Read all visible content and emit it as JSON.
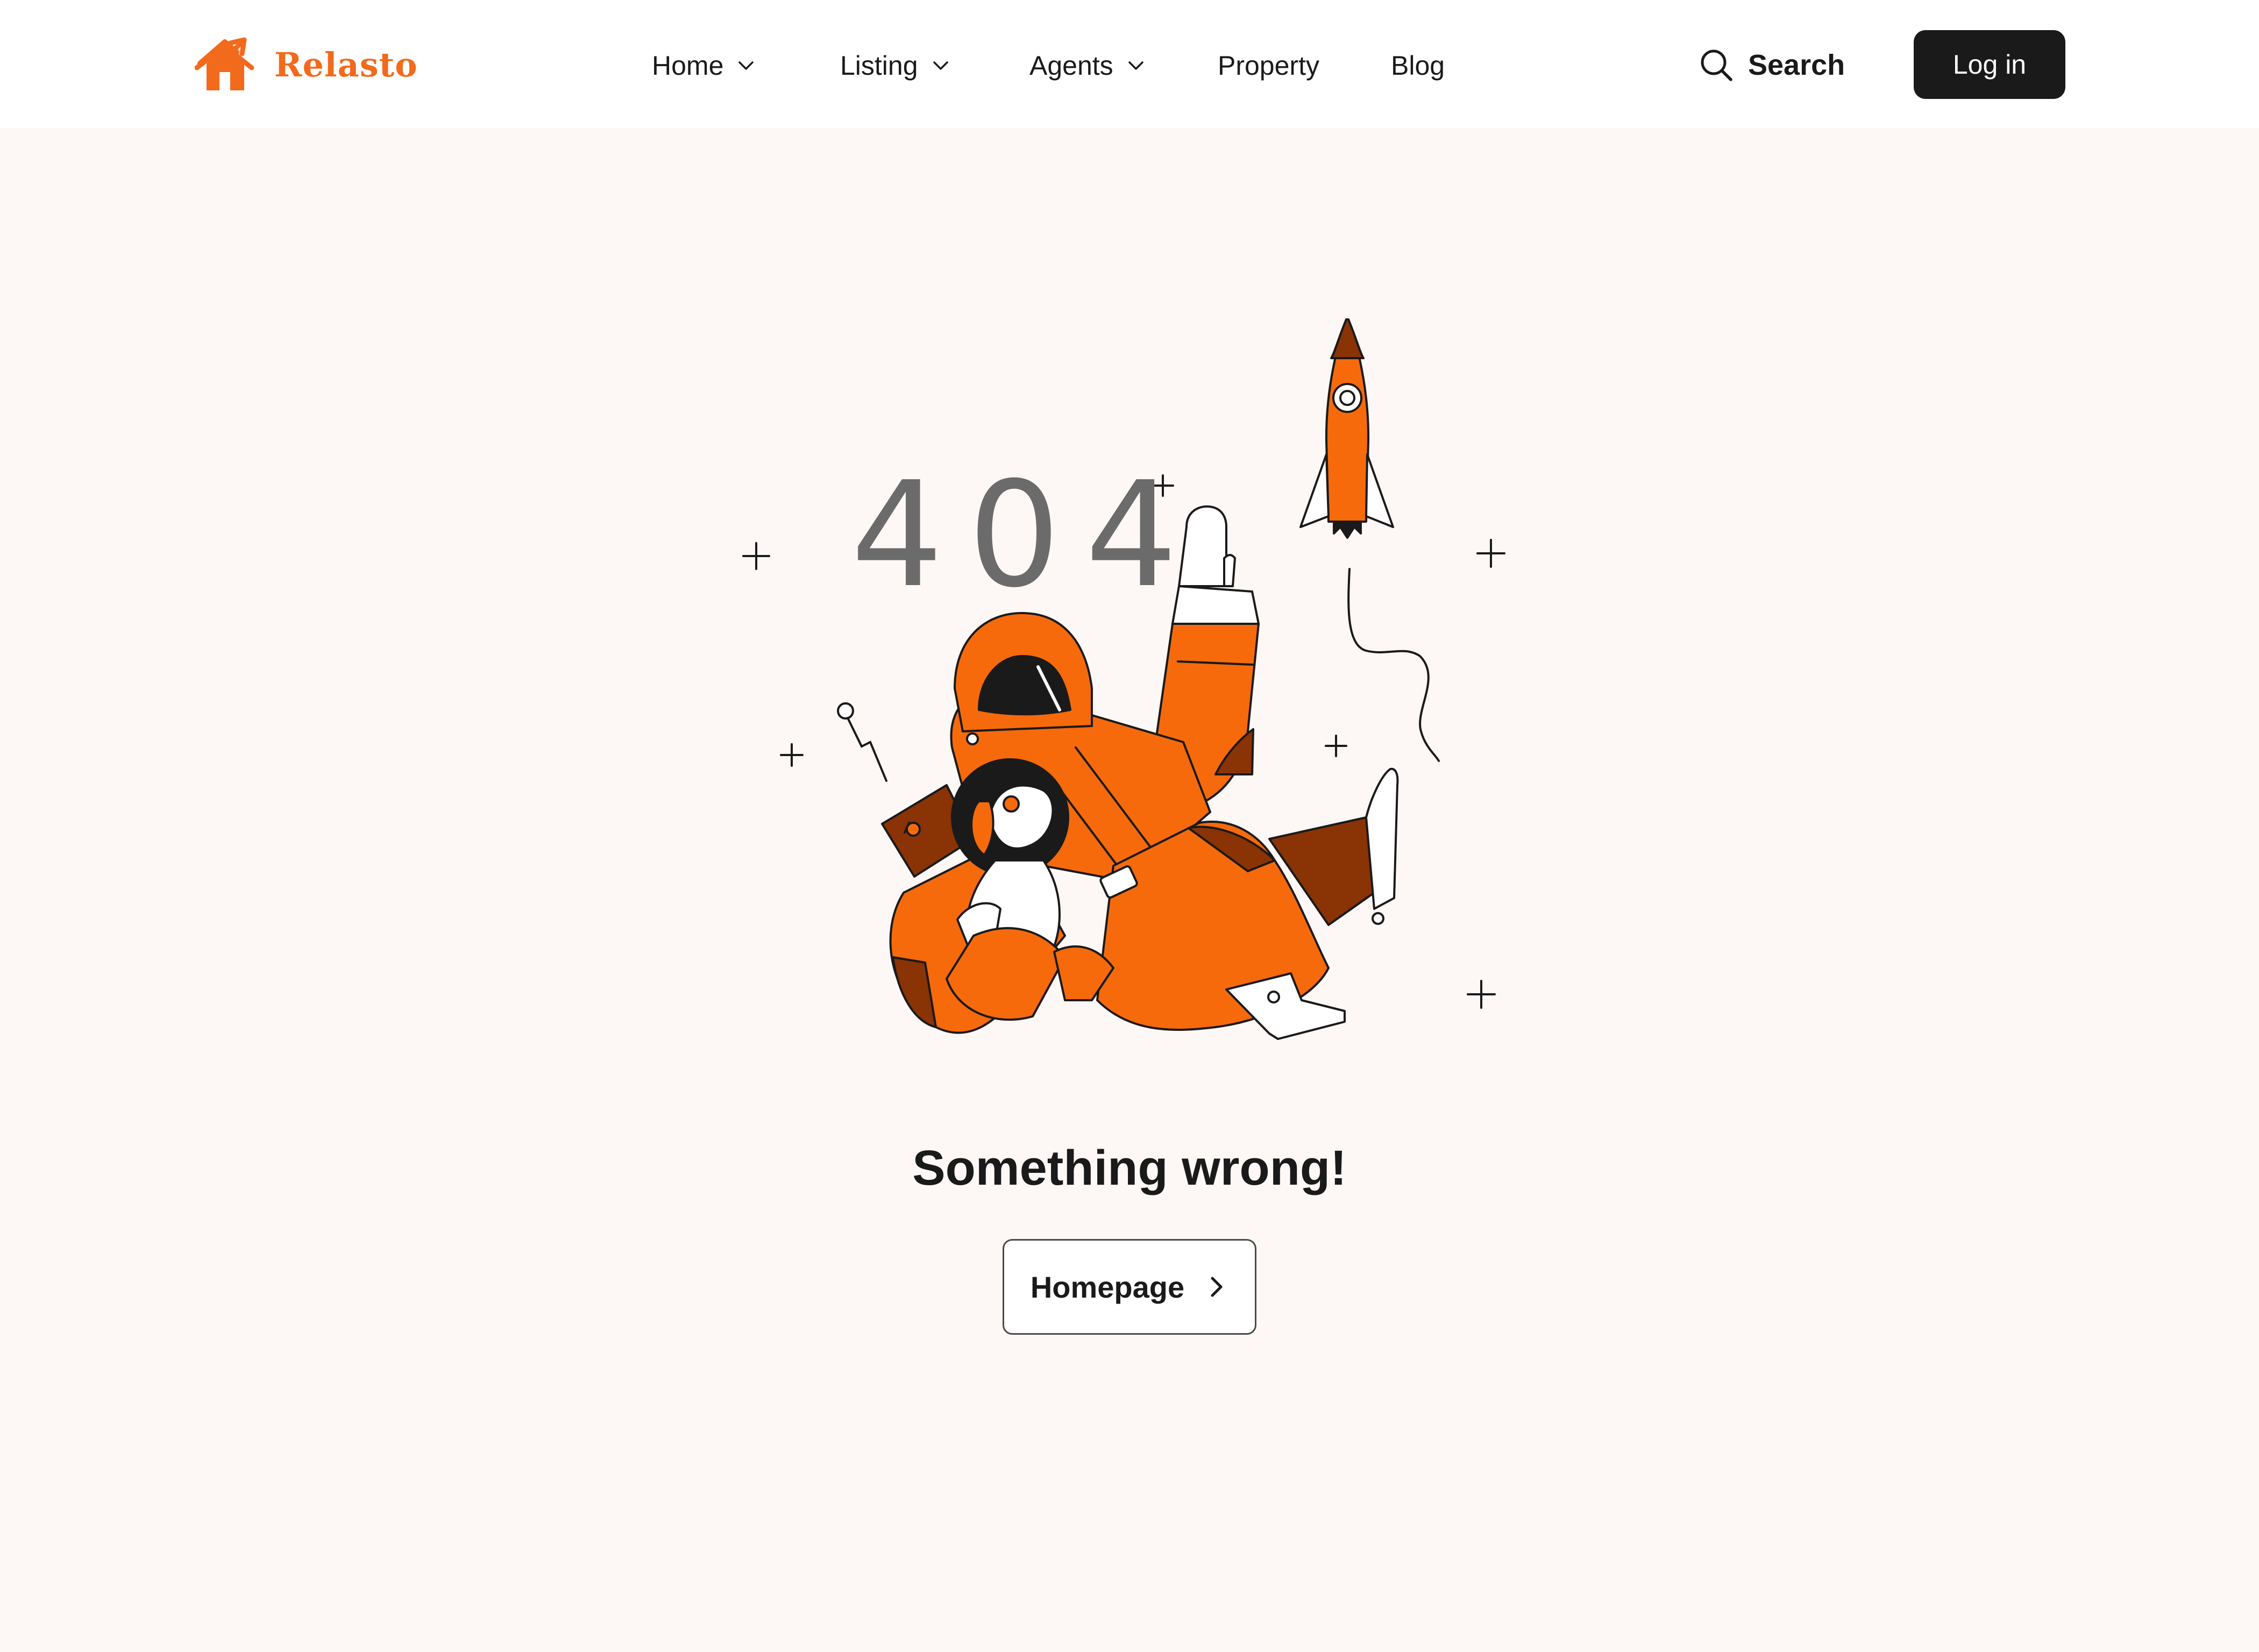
{
  "brand": {
    "name": "Relasto",
    "logo_icon": "house-logo-icon",
    "color": "#f26a1b"
  },
  "nav": {
    "items": [
      {
        "label": "Home",
        "has_dropdown": true
      },
      {
        "label": "Listing",
        "has_dropdown": true
      },
      {
        "label": "Agents",
        "has_dropdown": true
      },
      {
        "label": "Property",
        "has_dropdown": false
      },
      {
        "label": "Blog",
        "has_dropdown": false
      }
    ]
  },
  "header": {
    "search_label": "Search",
    "login_label": "Log in"
  },
  "error": {
    "code": "404",
    "message": "Something wrong!",
    "button_label": "Homepage",
    "illustration": "astronaut-with-dog-and-rocket"
  },
  "colors": {
    "accent": "#f26a1b",
    "dark": "#1a1a1a",
    "page_background": "#fdf8f6"
  }
}
